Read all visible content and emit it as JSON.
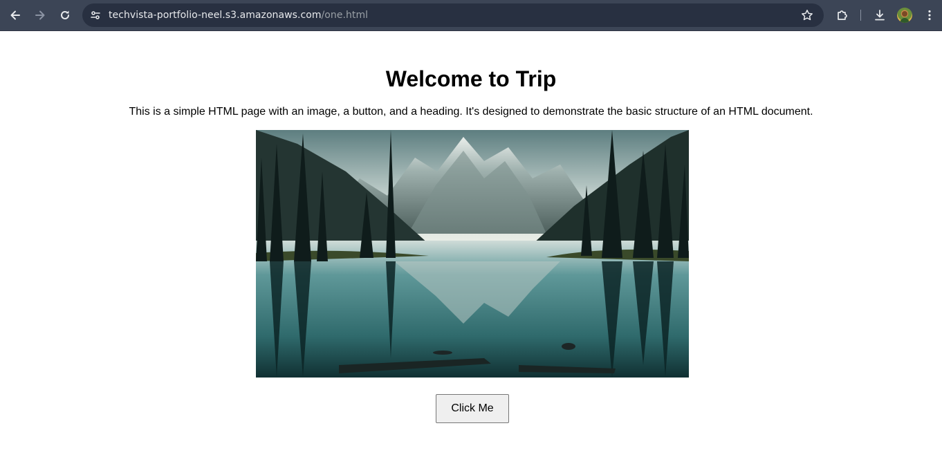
{
  "browser": {
    "url_host": "techvista-portfolio-neel.s3.amazonaws.com",
    "url_path": "/one.html",
    "toolbar_bg": "#3c4556",
    "icons": [
      "back-icon",
      "forward-icon",
      "reload-icon",
      "site-info-icon",
      "bookmark-star-icon",
      "extensions-icon",
      "download-icon",
      "profile-avatar",
      "menu-icon"
    ]
  },
  "page": {
    "title": "Welcome to Trip",
    "description": "This is a simple HTML page with an image, a button, and a heading. It's designed to demonstrate the basic structure of an HTML document.",
    "image_subject": "mountain-lake-landscape",
    "button_label": "Click Me"
  }
}
